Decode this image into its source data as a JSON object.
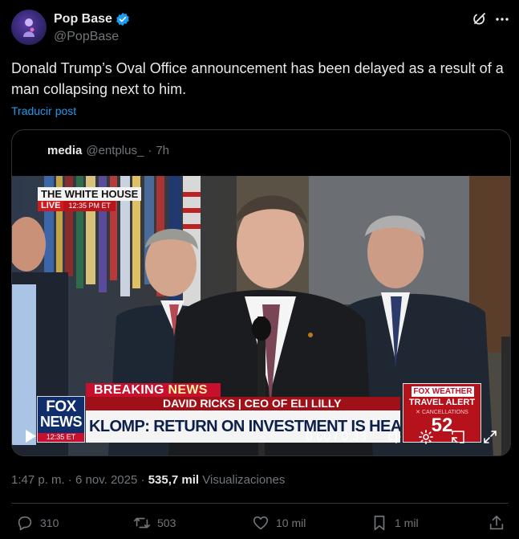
{
  "author": {
    "display_name": "Pop Base",
    "handle": "@PopBase",
    "verified": true,
    "avatar_icon": "avatar"
  },
  "post": {
    "text": "Donald Trump’s Oval Office announcement has been delayed as a result of a man collapsing next to him.",
    "translate_label": "Traducir post"
  },
  "quoted": {
    "name": "media",
    "handle": "@entplus_",
    "dot": "·",
    "time": "7h"
  },
  "video": {
    "bug_title": "THE WHITE HOUSE",
    "bug_live": "LIVE",
    "bug_time": "12:35 PM ET",
    "breaking_a": "BREAKING",
    "breaking_b": "NEWS",
    "nameplate": "DAVID RICKS | CEO OF ELI LILLY",
    "headline": "KLOMP: RETURN ON INVESTMENT IS HEALTHIER AMERICANS",
    "fox_top": "FOX",
    "fox_mid": "NEWS",
    "fox_time": "12:35 ET",
    "weather_logo": "FOX WEATHER",
    "weather_alert": "TRAVEL ALERT",
    "weather_sub": "✕ CANCELLATIONS",
    "weather_num": "52",
    "time_display": "0:00 / 0:33"
  },
  "meta": {
    "time": "1:47 p. m.",
    "sep": "·",
    "date": "6 nov. 2025",
    "views_num": "535,7 mil",
    "views_label": "Visualizaciones"
  },
  "actions": {
    "replies": "310",
    "reposts": "503",
    "likes": "10 mil",
    "bookmarks": "1 mil"
  },
  "colors": {
    "background": "#000000",
    "text": "#e7e9ea",
    "muted": "#71767b",
    "link": "#1d9bf0",
    "verified": "#1d9bf0",
    "border": "#2f3336"
  }
}
